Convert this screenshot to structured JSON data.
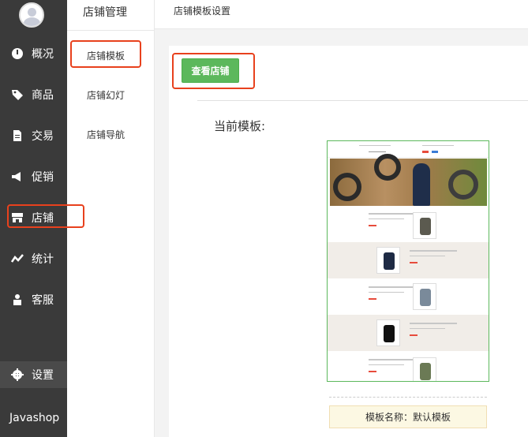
{
  "nav": {
    "items": [
      {
        "label": "概况",
        "icon": "dashboard-icon"
      },
      {
        "label": "商品",
        "icon": "tag-icon"
      },
      {
        "label": "交易",
        "icon": "document-icon"
      },
      {
        "label": "促销",
        "icon": "megaphone-icon"
      },
      {
        "label": "店铺",
        "icon": "store-icon"
      },
      {
        "label": "统计",
        "icon": "trend-icon"
      },
      {
        "label": "客服",
        "icon": "user-icon"
      }
    ],
    "settings": "设置",
    "brand": "Javashop"
  },
  "subnav": {
    "title": "店铺管理",
    "items": [
      "店铺模板",
      "店铺幻灯",
      "店铺导航"
    ]
  },
  "header": {
    "title": "店铺模板设置"
  },
  "main": {
    "view_store_button": "查看店铺",
    "current_template_label": "当前模板:",
    "template_name": "模板名称：默认模板"
  },
  "colors": {
    "nav_bg": "#3a3a3a",
    "accent_green": "#5cb85c",
    "highlight_red": "#e8411d"
  }
}
